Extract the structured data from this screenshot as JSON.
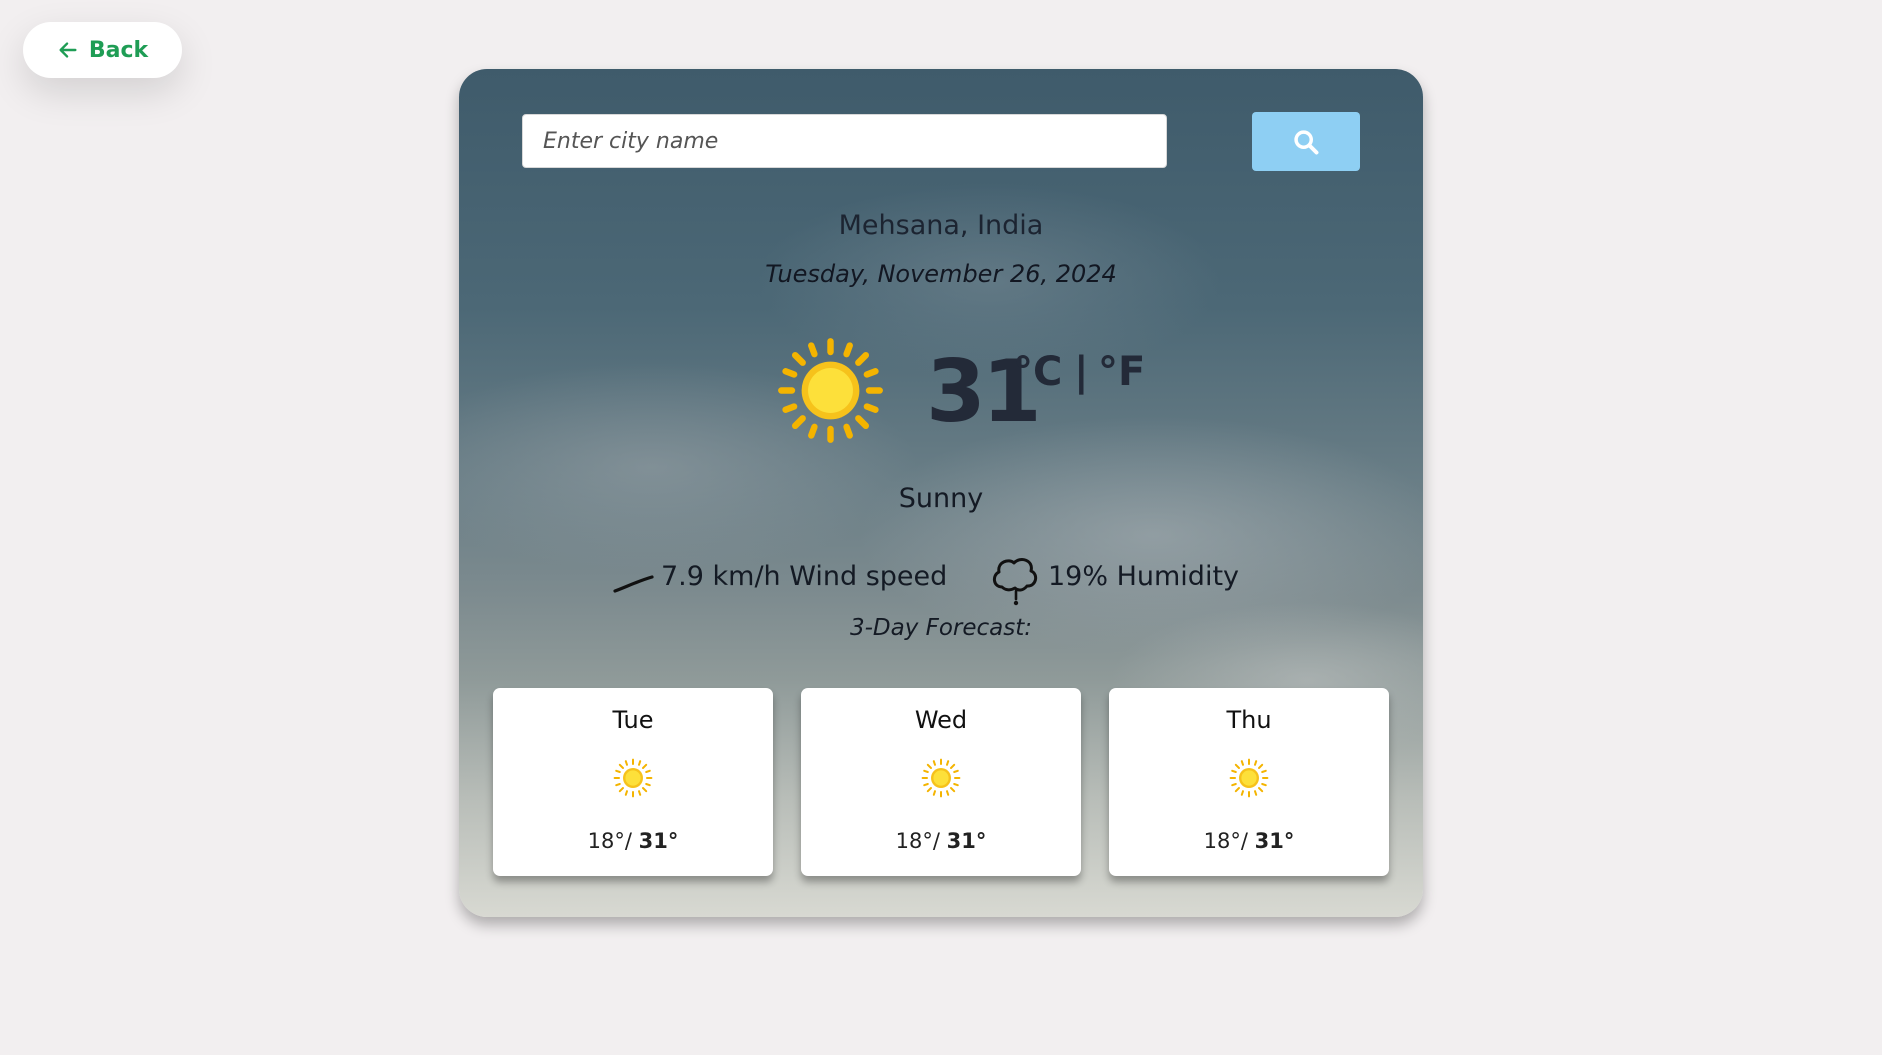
{
  "back_button": {
    "label": "Back",
    "icon": "arrow-left-icon",
    "color": "#1f9d55"
  },
  "search": {
    "placeholder": "Enter city name",
    "value": "",
    "button_icon": "search-icon",
    "button_color": "#8ecff3"
  },
  "location": "Mehsana, India",
  "date": "Tuesday, November 26, 2024",
  "current": {
    "icon": "sun-icon",
    "temperature": "31",
    "unit_celsius": "°C",
    "unit_separator": "|",
    "unit_fahrenheit": "°F",
    "condition": "Sunny"
  },
  "stats": {
    "wind_icon": "wind-icon",
    "wind_text": "7.9 km/h Wind speed",
    "humidity_icon": "humidity-icon",
    "humidity_text": "19% Humidity"
  },
  "forecast_title": "3-Day Forecast:",
  "forecast": [
    {
      "day": "Tue",
      "icon": "sun-icon",
      "low": "18°",
      "sep": "/ ",
      "high": "31°"
    },
    {
      "day": "Wed",
      "icon": "sun-icon",
      "low": "18°",
      "sep": "/ ",
      "high": "31°"
    },
    {
      "day": "Thu",
      "icon": "sun-icon",
      "low": "18°",
      "sep": "/ ",
      "high": "31°"
    }
  ]
}
